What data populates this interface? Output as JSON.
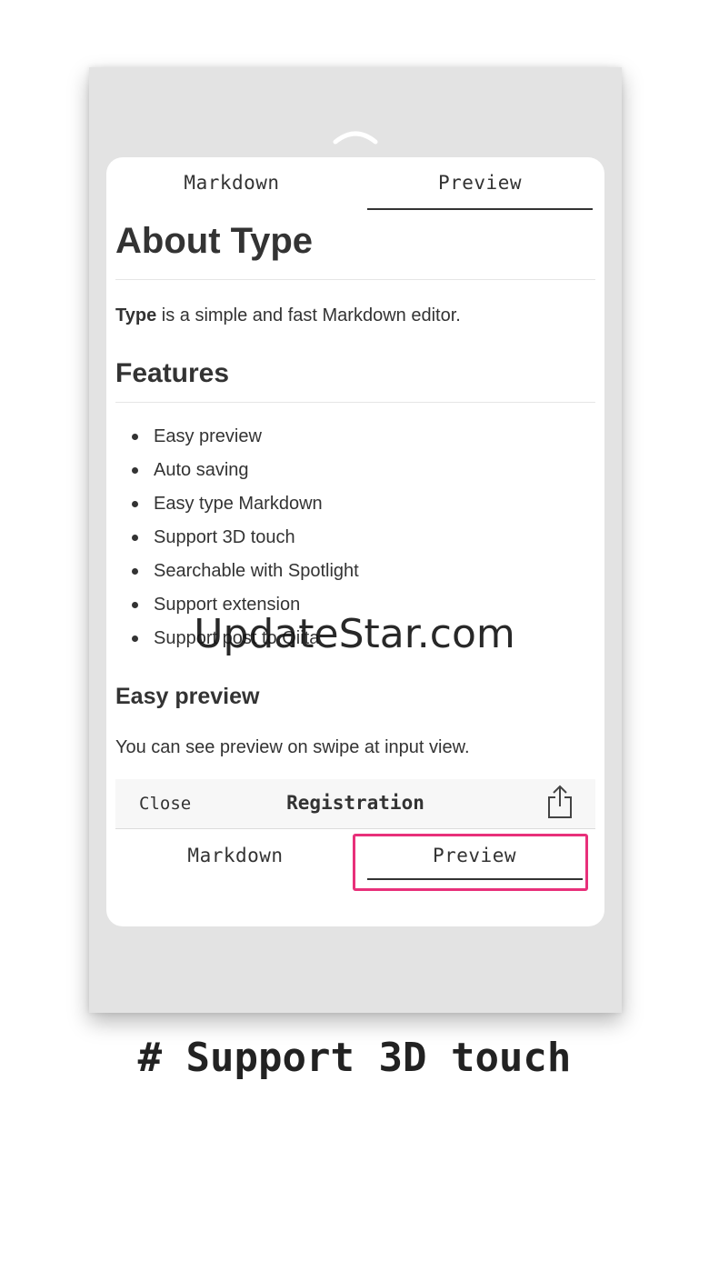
{
  "tabs_top": {
    "markdown": "Markdown",
    "preview": "Preview",
    "active": "Preview"
  },
  "doc": {
    "title": "About Type",
    "intro_bold": "Type",
    "intro_rest": " is a simple and fast Markdown editor.",
    "features_heading": "Features",
    "features": [
      "Easy preview",
      "Auto saving",
      "Easy type Markdown",
      "Support 3D touch",
      "Searchable with Spotlight",
      "Support extension",
      "Support post to Qiita"
    ],
    "easy_preview_heading": "Easy preview",
    "easy_preview_text": "You can see preview on swipe at input view."
  },
  "registration_bar": {
    "close": "Close",
    "title": "Registration",
    "share_icon": "share-icon"
  },
  "tabs_bottom": {
    "markdown": "Markdown",
    "preview": "Preview",
    "active": "Preview",
    "highlight_color": "#e8307a"
  },
  "watermark": "UpdateStar.com",
  "caption": "# Support 3D touch"
}
